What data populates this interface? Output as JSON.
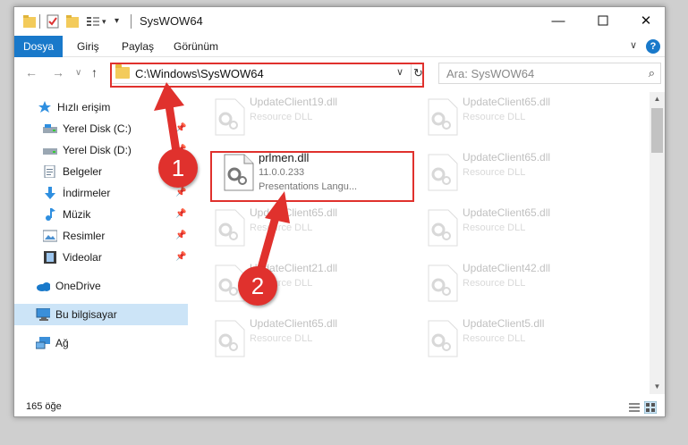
{
  "window": {
    "title": "SysWOW64",
    "minimize_label": "—",
    "maximize_label": "☐",
    "close_label": "✕"
  },
  "ribbon": {
    "tabs": [
      "Dosya",
      "Giriş",
      "Paylaş",
      "Görünüm"
    ],
    "expand_label": "∨",
    "help_label": "?"
  },
  "nav": {
    "back_label": "←",
    "forward_label": "→",
    "recent_label": "∨",
    "up_label": "↑",
    "address": "C:\\Windows\\SysWOW64",
    "address_dropdown": "∨",
    "refresh_label": "↻",
    "search_placeholder": "Ara: SysWOW64",
    "search_icon": "⌕"
  },
  "sidebar": {
    "items": [
      {
        "label": "Hızlı erişim",
        "icon": "star-icon"
      },
      {
        "label": "Yerel Disk (C:)",
        "icon": "drive-icon",
        "pinned": true
      },
      {
        "label": "Yerel Disk (D:)",
        "icon": "drive-icon",
        "pinned": true
      },
      {
        "label": "Belgeler",
        "icon": "documents-icon",
        "pinned": true
      },
      {
        "label": "İndirmeler",
        "icon": "download-icon",
        "pinned": true
      },
      {
        "label": "Müzik",
        "icon": "music-icon",
        "pinned": true
      },
      {
        "label": "Resimler",
        "icon": "pictures-icon",
        "pinned": true
      },
      {
        "label": "Videolar",
        "icon": "videos-icon",
        "pinned": true
      },
      {
        "label": "OneDrive",
        "icon": "cloud-icon"
      },
      {
        "label": "Bu bilgisayar",
        "icon": "computer-icon"
      },
      {
        "label": "Ağ",
        "icon": "network-icon"
      }
    ],
    "pin_glyph": "📌"
  },
  "files": [
    {
      "name": "UpdateClient19.dll",
      "detail": "Resource DLL",
      "faded": true
    },
    {
      "name": "UpdateClient65.dll",
      "detail": "Resource DLL",
      "faded": true
    },
    {
      "name": "prlmen.dll",
      "version": "11.0.0.233",
      "description": "Presentations Langu...",
      "faded": false
    },
    {
      "name": "UpdateClient65.dll",
      "detail": "Resource DLL",
      "faded": true
    },
    {
      "name": "UpdateClient65.dll",
      "detail": "Resource DLL",
      "faded": true
    },
    {
      "name": "UpdateClient65.dll",
      "detail": "Resource DLL",
      "faded": true
    },
    {
      "name": "UpdateClient21.dll",
      "detail": "Resource DLL",
      "faded": true
    },
    {
      "name": "UpdateClient42.dll",
      "detail": "Resource DLL",
      "faded": true
    },
    {
      "name": "UpdateClient65.dll",
      "detail": "Resource DLL",
      "faded": true
    },
    {
      "name": "UpdateClient5.dll",
      "detail": "Resource DLL",
      "faded": true
    }
  ],
  "status": {
    "count": "165 öğe"
  },
  "annotations": {
    "step1": "1",
    "step2": "2",
    "color": "#e0312d"
  },
  "colors": {
    "accent": "#1979ca",
    "selected": "#cce4f7"
  }
}
